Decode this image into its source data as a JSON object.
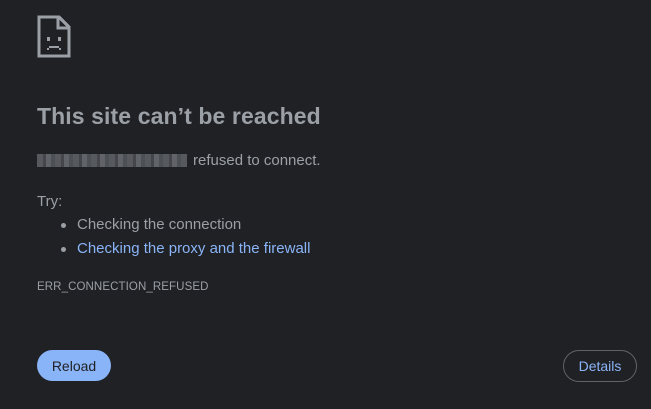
{
  "icon": {
    "name": "sad-page-icon",
    "color": "#9aa0a6"
  },
  "main": {
    "title": "This site can’t be reached",
    "refused_text": "refused to connect.",
    "try_label": "Try:",
    "suggestions": [
      {
        "label": "Checking the connection",
        "is_link": false
      },
      {
        "label": "Checking the proxy and the firewall",
        "is_link": true
      }
    ],
    "error_code": "ERR_CONNECTION_REFUSED"
  },
  "buttons": {
    "reload_label": "Reload",
    "details_label": "Details"
  },
  "colors": {
    "background": "#202124",
    "text": "#9aa0a6",
    "accent": "#8ab4f8"
  }
}
